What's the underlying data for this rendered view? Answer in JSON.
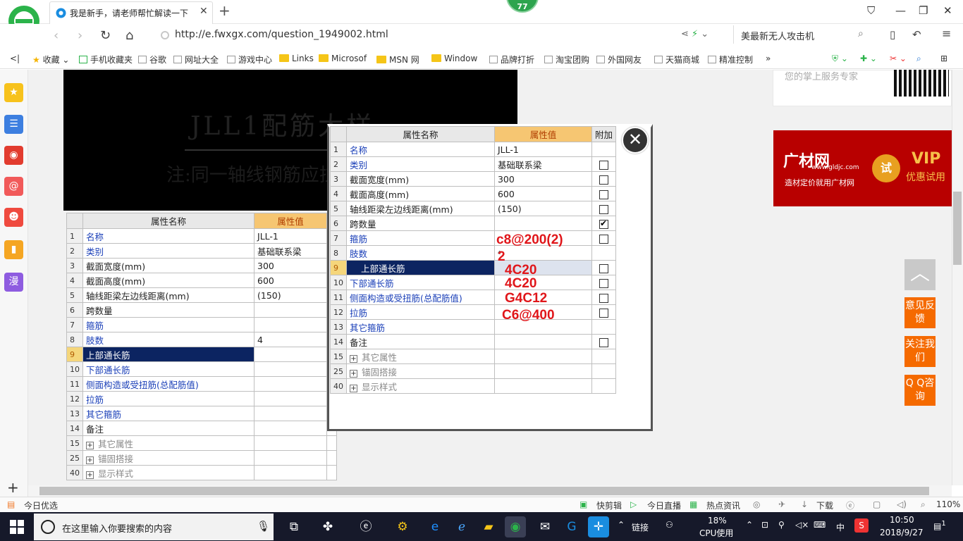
{
  "browser": {
    "tab_title": "我是新手，请老师帮忙解读一下",
    "badge_count": "77",
    "url": "http://e.fwxgx.com/question_1949002.html",
    "search_text": "美最新无人攻击机",
    "bookmarks": [
      "收藏",
      "手机收藏夹",
      "谷歌",
      "网址大全",
      "游戏中心",
      "Links",
      "Microsof",
      "MSN 网",
      "Window",
      "品牌打折",
      "淘宝团购",
      "外国网友",
      "天猫商城",
      "精准控制"
    ]
  },
  "cad": {
    "title": "JLL1配筋大样",
    "note": "注:同一轴线钢筋应拉通"
  },
  "table": {
    "col_name": "属性名称",
    "col_value": "属性值",
    "col_extra": "附加",
    "rows": [
      {
        "num": "1",
        "name": "名称",
        "value": "JLL-1",
        "cb": false
      },
      {
        "num": "2",
        "name": "类别",
        "value": "基础联系梁",
        "cb": true
      },
      {
        "num": "3",
        "name": "截面宽度(mm)",
        "value": "300",
        "cb": true
      },
      {
        "num": "4",
        "name": "截面高度(mm)",
        "value": "600",
        "cb": true
      },
      {
        "num": "5",
        "name": "轴线距梁左边线距离(mm)",
        "value": "(150)",
        "cb": true
      },
      {
        "num": "6",
        "name": "跨数量",
        "value": "",
        "cb": true
      },
      {
        "num": "7",
        "name": "箍筋",
        "value": "",
        "cb": true
      },
      {
        "num": "8",
        "name": "肢数",
        "value": "4",
        "cb": false
      },
      {
        "num": "9",
        "name": "上部通长筋",
        "value": "",
        "cb": true
      },
      {
        "num": "10",
        "name": "下部通长筋",
        "value": "",
        "cb": true
      },
      {
        "num": "11",
        "name": "侧面构造或受扭筋(总配筋值)",
        "value": "",
        "cb": true
      },
      {
        "num": "12",
        "name": "拉筋",
        "value": "",
        "cb": true
      },
      {
        "num": "13",
        "name": "其它箍筋",
        "value": "",
        "cb": false
      },
      {
        "num": "14",
        "name": "备注",
        "value": "",
        "cb": true
      },
      {
        "num": "15",
        "name": "其它属性",
        "value": "",
        "cb": false
      },
      {
        "num": "25",
        "name": "锚固搭接",
        "value": "",
        "cb": false
      },
      {
        "num": "40",
        "name": "显示样式",
        "value": "",
        "cb": false
      }
    ],
    "handwritten": {
      "stirrup": "c8@200(2)",
      "legs": "2",
      "top_bar": "4C20",
      "bottom_bar": "4C20",
      "side_bar": "G4C12",
      "tie_bar": "C6@400"
    }
  },
  "right": {
    "card_text": "您的掌上服务专家",
    "ad_brand": "广材网",
    "ad_url": "www.gldjc.com",
    "ad_slogan": "造材定价就用广材网",
    "ad_try": "试",
    "ad_vip": "VIP",
    "ad_vip_sub": "优惠试用",
    "feedback": "意见反馈",
    "follow": "关注我们",
    "qq": "Q Q咨询"
  },
  "status": {
    "today": "今日优选",
    "items": [
      "快剪辑",
      "今日直播",
      "热点资讯",
      "下载"
    ],
    "zoom": "110%"
  },
  "taskbar": {
    "search_placeholder": "在这里输入你要搜索的内容",
    "link_label": "链接",
    "cpu_pct": "18%",
    "cpu_label": "CPU使用",
    "ime": "中",
    "time": "10:50",
    "date": "2018/9/27",
    "notif_count": "1"
  },
  "colors": {
    "accent_red": "#e0161a",
    "selected_row": "#0c2461",
    "header_value_bg": "#f6c672",
    "orange_btn": "#f56a00",
    "ad_red": "#b80000"
  }
}
